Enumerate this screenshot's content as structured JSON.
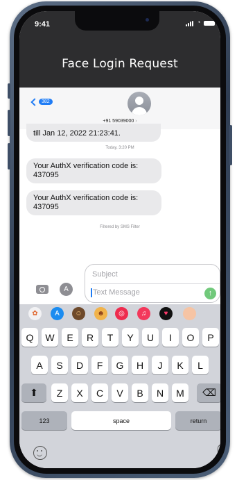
{
  "status_bar": {
    "time": "9:41",
    "signal_icon": "cellular-signal-icon",
    "wifi_icon": "wifi-icon",
    "battery_icon": "battery-icon"
  },
  "overlay_title": "Face Login Request",
  "conversation": {
    "back_badge": "382",
    "contact_number": "+91 59039000",
    "messages": [
      {
        "text": "till Jan 12, 2022 21:23:41."
      },
      {
        "text": "Your AuthX verification code is: 437095"
      },
      {
        "text": "Your AuthX verification code is: 437095"
      }
    ],
    "timestamp": "Today, 3:20 PM",
    "filter_note": "Filtered by SMS Filter"
  },
  "composer": {
    "subject_placeholder": "Subject",
    "message_placeholder": "Text Message",
    "send_icon": "arrow-up-icon",
    "camera_icon": "camera-icon",
    "apps_icon": "app-store-icon"
  },
  "app_strip": [
    {
      "name": "photos-app-icon",
      "color": "#f2f2f4",
      "glyph": "✿",
      "glyph_color": "#e0662d"
    },
    {
      "name": "app-store-icon",
      "color": "#1b8cf0",
      "glyph": "A",
      "glyph_color": "#ffffff"
    },
    {
      "name": "memoji-icon",
      "color": "#6e4a2b",
      "glyph": "☺",
      "glyph_color": "#f4c27a"
    },
    {
      "name": "memoji-sticker-icon",
      "color": "#f1b34b",
      "glyph": "☻",
      "glyph_color": "#8b3f1a"
    },
    {
      "name": "search-images-icon",
      "color": "#ee2c4e",
      "glyph": "◎",
      "glyph_color": "#ffffff"
    },
    {
      "name": "music-icon",
      "color": "#f3385b",
      "glyph": "♫",
      "glyph_color": "#ffffff"
    },
    {
      "name": "digital-touch-icon",
      "color": "#111111",
      "glyph": "♥",
      "glyph_color": "#ff3b6b"
    },
    {
      "name": "more-apps-icon",
      "color": "#f6c4a4",
      "glyph": "",
      "glyph_color": "#ffffff"
    }
  ],
  "keyboard": {
    "row1": [
      "Q",
      "W",
      "E",
      "R",
      "T",
      "Y",
      "U",
      "I",
      "O",
      "P"
    ],
    "row2": [
      "A",
      "S",
      "D",
      "F",
      "G",
      "H",
      "J",
      "K",
      "L"
    ],
    "row3": [
      "Z",
      "X",
      "C",
      "V",
      "B",
      "N",
      "M"
    ],
    "shift_icon": "shift-icon",
    "backspace_icon": "backspace-icon",
    "numbers_label": "123",
    "space_label": "space",
    "return_label": "return",
    "emoji_icon": "emoji-icon",
    "mic_icon": "microphone-icon"
  }
}
